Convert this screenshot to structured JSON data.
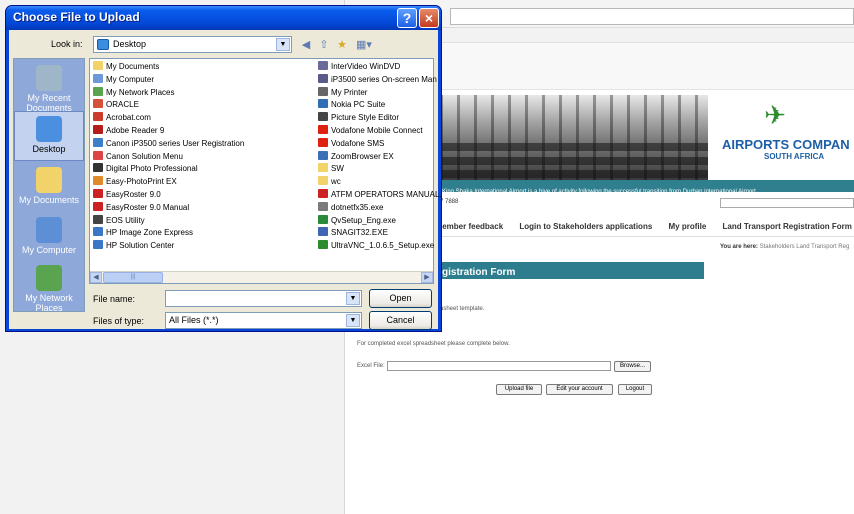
{
  "browser": {
    "site": {
      "logo_text": "AIRPORTS COMPAN",
      "logo_sub": "SOUTH AFRICA",
      "news": "King Shaka International Airport is a hive of activity following the successful transition from Durban international Airport.",
      "phone": "7 7888",
      "nav": [
        "lember feedback",
        "Login to Stakeholders applications",
        "My profile",
        "Land Transport Registration Form"
      ],
      "breadcrumb_label": "You are here:",
      "breadcrumb_path": "Stakeholders  Land Transport Reg"
    },
    "form": {
      "title": "gistration Form",
      "template_text": "asheet template.",
      "instructions": "For completed excel spreadsheet please complete below.",
      "excel_label": "Excel File:",
      "browse_label": "Browse...",
      "upload_label": "Upload file",
      "edit_label": "Edit your account",
      "logout_label": "Logout"
    }
  },
  "dialog": {
    "title": "Choose File to Upload",
    "help_glyph": "?",
    "close_glyph": "×",
    "look_in_label": "Look in:",
    "look_in_value": "Desktop",
    "places": [
      {
        "label": "My Recent\nDocuments",
        "color": "#9fb6c9"
      },
      {
        "label": "Desktop",
        "color": "#4a8fe0"
      },
      {
        "label": "My Documents",
        "color": "#f1d36a"
      },
      {
        "label": "My Computer",
        "color": "#5c8fd6"
      },
      {
        "label": "My Network\nPlaces",
        "color": "#5aa34f"
      }
    ],
    "files_col1": [
      {
        "name": "My Documents",
        "color": "#f1d36a"
      },
      {
        "name": "My Computer",
        "color": "#6f98d8"
      },
      {
        "name": "My Network Places",
        "color": "#5aa34f"
      },
      {
        "name": "ORACLE",
        "color": "#d6503a"
      },
      {
        "name": "Acrobat.com",
        "color": "#cc3b2a"
      },
      {
        "name": "Adobe Reader 9",
        "color": "#b51c1c"
      },
      {
        "name": "Canon iP3500 series User Registration",
        "color": "#3d7fc8"
      },
      {
        "name": "Canon Solution Menu",
        "color": "#d44"
      },
      {
        "name": "Digital Photo Professional",
        "color": "#333"
      },
      {
        "name": "Easy-PhotoPrint EX",
        "color": "#e08b2a"
      },
      {
        "name": "EasyRoster 9.0",
        "color": "#c22"
      },
      {
        "name": "EasyRoster 9.0 Manual",
        "color": "#c22"
      },
      {
        "name": "EOS Utility",
        "color": "#444"
      },
      {
        "name": "HP Image Zone Express",
        "color": "#3a77c6"
      },
      {
        "name": "HP Solution Center",
        "color": "#3a77c6"
      }
    ],
    "files_col2": [
      {
        "name": "InterVideo WinDVD",
        "color": "#6a6a9a"
      },
      {
        "name": "iP3500 series On-screen Man",
        "color": "#5a5a8a"
      },
      {
        "name": "My Printer",
        "color": "#666"
      },
      {
        "name": "Nokia PC Suite",
        "color": "#2f6db5"
      },
      {
        "name": "Picture Style Editor",
        "color": "#444"
      },
      {
        "name": "Vodafone Mobile Connect",
        "color": "#d21"
      },
      {
        "name": "Vodafone SMS",
        "color": "#d21"
      },
      {
        "name": "ZoomBrowser EX",
        "color": "#3b6fb5"
      },
      {
        "name": "SW",
        "color": "#f1d36a"
      },
      {
        "name": "wc",
        "color": "#f1d36a"
      },
      {
        "name": "ATFM OPERATORS MANUAL.",
        "color": "#c22"
      },
      {
        "name": "dotnetfx35.exe",
        "color": "#7a7a7a"
      },
      {
        "name": "QvSetup_Eng.exe",
        "color": "#2b8a3a"
      },
      {
        "name": "SNAGIT32.EXE",
        "color": "#3d66b5"
      },
      {
        "name": "UltraVNC_1.0.6.5_Setup.exe",
        "color": "#2d8a2d"
      }
    ],
    "scroll_left": "◀",
    "scroll_right": "▶",
    "scroll_thumb": "|||",
    "file_name_label": "File name:",
    "file_name_value": "",
    "files_of_type_label": "Files of type:",
    "files_of_type_value": "All Files (*.*)",
    "open_label": "Open",
    "cancel_label": "Cancel",
    "combo_arrow": "▼"
  }
}
